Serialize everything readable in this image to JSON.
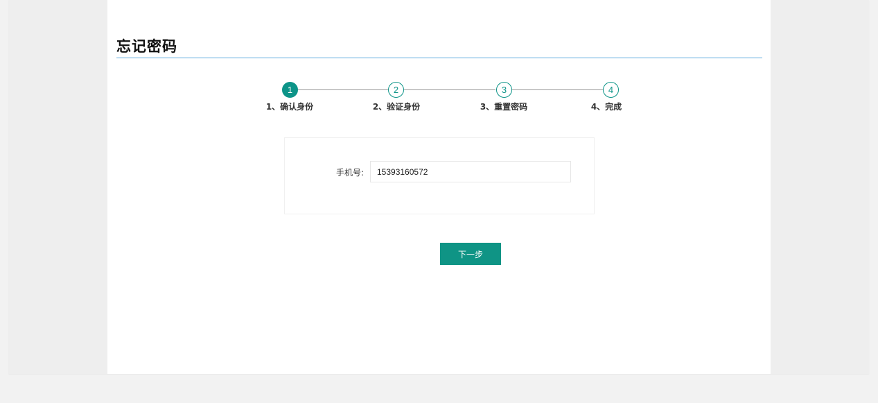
{
  "page": {
    "title": "忘记密码"
  },
  "steps": [
    {
      "number": "1",
      "label": "1、确认身份",
      "active": true
    },
    {
      "number": "2",
      "label": "2、验证身份",
      "active": false
    },
    {
      "number": "3",
      "label": "3、重置密码",
      "active": false
    },
    {
      "number": "4",
      "label": "4、完成",
      "active": false
    }
  ],
  "form": {
    "phone_label": "手机号:",
    "phone_value": "15393160572"
  },
  "actions": {
    "next_label": "下一步"
  },
  "colors": {
    "accent": "#0d9488",
    "title_rule": "#5aa9dd"
  }
}
